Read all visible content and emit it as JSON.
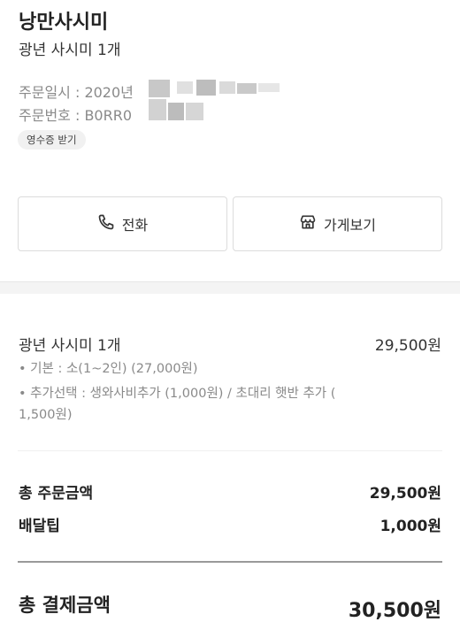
{
  "header": {
    "store_name": "낭만사시미",
    "order_summary": "광년 사시미 1개"
  },
  "order_meta": {
    "date_text": "주문일시 : 2020년",
    "number_text": "주문번호 : B0RR0"
  },
  "receipt_button": {
    "label": "영수증 받기"
  },
  "actions": {
    "call_label": "전화",
    "store_label": "가게보기"
  },
  "item": {
    "name": "광년 사시미 1개",
    "price": "29,500원",
    "options": [
      "• 기본 : 소(1~2인) (27,000원)",
      "• 추가선택 : 생와사비추가 (1,000원) / 초대리 햇반 추가 ( 1,500원)"
    ]
  },
  "summary": {
    "subtotal_label": "총 주문금액",
    "subtotal_value": "29,500원",
    "tip_label": "배달팁",
    "tip_value": "1,000원",
    "total_label": "총 결제금액",
    "total_value": "30,500원"
  },
  "icons": {
    "call": "phone-icon",
    "store": "storefront-icon"
  }
}
